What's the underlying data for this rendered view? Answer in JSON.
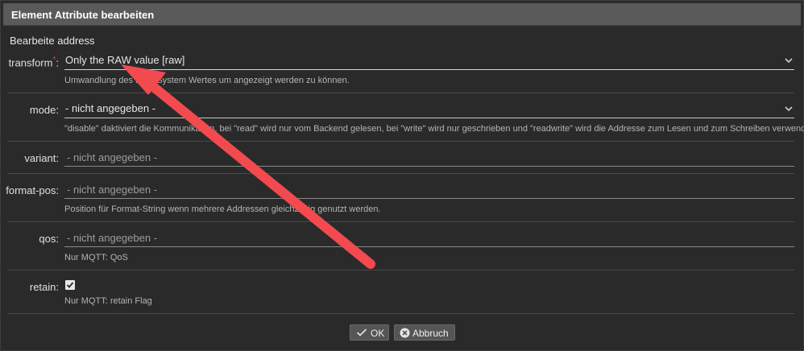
{
  "dialog": {
    "title": "Element Attribute bearbeiten",
    "subtitle": "Bearbeite address"
  },
  "fields": {
    "transform": {
      "label": "transform",
      "required_mark": "*",
      "colon": ":",
      "value": "Only the RAW value [raw]",
      "help": "Umwandlung des KNX-System Wertes um angezeigt werden zu können."
    },
    "mode": {
      "label": "mode:",
      "value": "- nicht angegeben -",
      "help": "\"disable\" daktiviert die Kommunikation, bei \"read\" wird nur vom Backend gelesen, bei \"write\" wird nur geschrieben und \"readwrite\" wird die Addresse zum Lesen und zum Schreiben verwendet."
    },
    "variant": {
      "label": "variant:",
      "placeholder": "- nicht angegeben -"
    },
    "format_pos": {
      "label": "format-pos:",
      "placeholder": "- nicht angegeben -",
      "help": "Position für Format-String wenn mehrere Addressen gleichzeitig genutzt werden."
    },
    "qos": {
      "label": "qos:",
      "placeholder": "- nicht angegeben -",
      "help": "Nur MQTT: QoS"
    },
    "retain": {
      "label": "retain:",
      "checked": true,
      "help": "Nur MQTT: retain Flag"
    }
  },
  "buttons": {
    "ok": "OK",
    "cancel": "Abbruch"
  },
  "annotation": {
    "arrow_color": "#f24a4f"
  }
}
